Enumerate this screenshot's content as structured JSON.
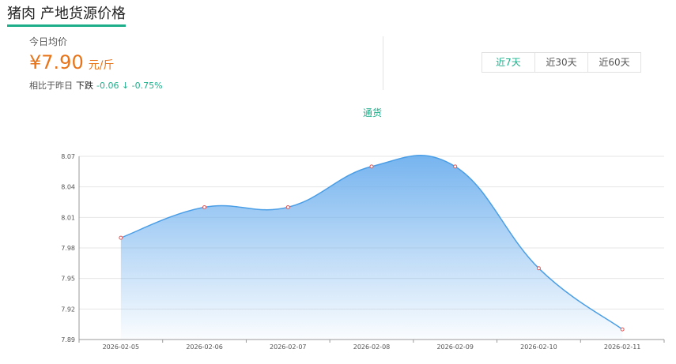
{
  "header": {
    "product": "猪肉",
    "subtitle": "产地货源价格"
  },
  "price": {
    "label": "今日均价",
    "value": "¥7.90",
    "unit": "元/斤",
    "compare_label": "相比于昨日",
    "trend_word": "下跌",
    "delta": "-0.06 ↓ -0.75%"
  },
  "range_tabs": [
    {
      "label": "近7天",
      "active": true
    },
    {
      "label": "近30天",
      "active": false
    },
    {
      "label": "近60天",
      "active": false
    }
  ],
  "series_tab": "通货",
  "colors": {
    "accent": "#1fae8a",
    "price": "#e8741a",
    "line": "#4a9ee6",
    "area_top": "#6fb0ee",
    "point": "#e05555"
  },
  "chart_data": {
    "type": "area",
    "x": [
      "2026-02-05",
      "2026-02-06",
      "2026-02-07",
      "2026-02-08",
      "2026-02-09",
      "2026-02-10",
      "2026-02-11"
    ],
    "series": [
      {
        "values": [
          7.99,
          8.02,
          8.02,
          8.06,
          8.06,
          7.96,
          7.9
        ]
      }
    ],
    "yticks": [
      "7.89",
      "7.92",
      "7.95",
      "7.98",
      "8.01",
      "8.04",
      "8.07"
    ],
    "ylim": [
      7.89,
      8.07
    ],
    "grid": true,
    "smooth": true,
    "title": "",
    "xlabel": "",
    "ylabel": ""
  }
}
